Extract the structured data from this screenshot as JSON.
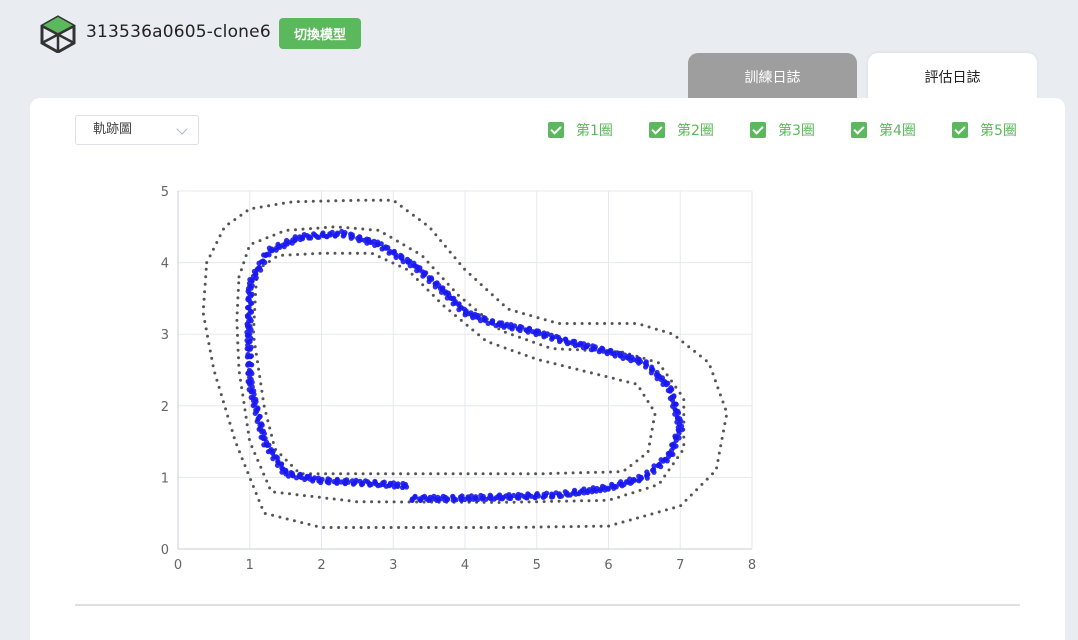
{
  "header": {
    "model_name": "313536a0605-clone6",
    "switch_button": "切換模型"
  },
  "tabs": [
    {
      "label": "訓練日誌",
      "active": false
    },
    {
      "label": "評估日誌",
      "active": true
    }
  ],
  "view_select": {
    "value": "軌跡圖"
  },
  "laps": [
    {
      "label": "第1圈",
      "checked": true
    },
    {
      "label": "第2圈",
      "checked": true
    },
    {
      "label": "第3圈",
      "checked": true
    },
    {
      "label": "第4圈",
      "checked": true
    },
    {
      "label": "第5圈",
      "checked": true
    }
  ],
  "colors": {
    "accent": "#5cb85c",
    "track": "#555555",
    "trajectory": "#1a1aee"
  },
  "chart_data": {
    "type": "scatter",
    "title": "",
    "xlabel": "",
    "ylabel": "",
    "xlim": [
      0,
      8
    ],
    "ylim": [
      0,
      5
    ],
    "xticks": [
      "0",
      "1",
      "2",
      "3",
      "4",
      "5",
      "6",
      "7",
      "8"
    ],
    "yticks": [
      "0",
      "1",
      "2",
      "3",
      "4",
      "5"
    ],
    "grid": true,
    "series": [
      {
        "role": "track-border-outer",
        "color": "#555555",
        "points": [
          [
            0.4,
            4.0
          ],
          [
            0.65,
            4.5
          ],
          [
            1.0,
            4.75
          ],
          [
            1.6,
            4.85
          ],
          [
            2.5,
            4.87
          ],
          [
            3.0,
            4.87
          ],
          [
            3.5,
            4.5
          ],
          [
            4.0,
            3.9
          ],
          [
            4.6,
            3.35
          ],
          [
            5.3,
            3.15
          ],
          [
            6.4,
            3.15
          ],
          [
            6.9,
            3.0
          ],
          [
            7.4,
            2.6
          ],
          [
            7.65,
            1.9
          ],
          [
            7.5,
            1.1
          ],
          [
            7.0,
            0.6
          ],
          [
            6.0,
            0.32
          ],
          [
            4.5,
            0.3
          ],
          [
            2.0,
            0.3
          ],
          [
            1.2,
            0.5
          ],
          [
            0.8,
            1.5
          ],
          [
            0.5,
            2.5
          ],
          [
            0.35,
            3.3
          ],
          [
            0.4,
            4.0
          ]
        ]
      },
      {
        "role": "track-border-inner",
        "color": "#555555",
        "points": [
          [
            1.1,
            3.9
          ],
          [
            1.4,
            4.1
          ],
          [
            2.0,
            4.13
          ],
          [
            2.7,
            4.13
          ],
          [
            3.2,
            3.9
          ],
          [
            3.7,
            3.4
          ],
          [
            4.3,
            2.9
          ],
          [
            5.0,
            2.65
          ],
          [
            6.0,
            2.4
          ],
          [
            6.4,
            2.3
          ],
          [
            6.65,
            1.9
          ],
          [
            6.55,
            1.35
          ],
          [
            6.2,
            1.08
          ],
          [
            5.0,
            1.05
          ],
          [
            3.0,
            1.05
          ],
          [
            1.7,
            1.05
          ],
          [
            1.35,
            1.4
          ],
          [
            1.2,
            2.0
          ],
          [
            1.05,
            3.0
          ],
          [
            1.1,
            3.9
          ]
        ]
      },
      {
        "role": "track-centerline",
        "color": "#555555",
        "points": [
          [
            0.85,
            3.8
          ],
          [
            1.0,
            4.25
          ],
          [
            1.5,
            4.45
          ],
          [
            2.2,
            4.5
          ],
          [
            2.8,
            4.45
          ],
          [
            3.4,
            4.1
          ],
          [
            3.9,
            3.55
          ],
          [
            4.5,
            3.05
          ],
          [
            5.2,
            2.8
          ],
          [
            6.2,
            2.75
          ],
          [
            6.7,
            2.6
          ],
          [
            7.05,
            2.1
          ],
          [
            7.05,
            1.4
          ],
          [
            6.7,
            0.9
          ],
          [
            6.0,
            0.68
          ],
          [
            4.5,
            0.65
          ],
          [
            2.5,
            0.66
          ],
          [
            1.3,
            0.8
          ],
          [
            1.0,
            1.5
          ],
          [
            0.85,
            2.5
          ],
          [
            0.82,
            3.2
          ],
          [
            0.85,
            3.8
          ]
        ]
      },
      {
        "role": "trajectory",
        "color": "#1a1aee",
        "points": [
          [
            3.15,
            0.88
          ],
          [
            2.6,
            0.92
          ],
          [
            2.0,
            0.95
          ],
          [
            1.5,
            1.05
          ],
          [
            1.2,
            1.5
          ],
          [
            1.0,
            2.3
          ],
          [
            0.98,
            3.0
          ],
          [
            1.0,
            3.7
          ],
          [
            1.25,
            4.15
          ],
          [
            1.7,
            4.35
          ],
          [
            2.3,
            4.4
          ],
          [
            2.8,
            4.25
          ],
          [
            3.3,
            3.95
          ],
          [
            3.7,
            3.6
          ],
          [
            4.0,
            3.3
          ],
          [
            4.4,
            3.15
          ],
          [
            4.9,
            3.05
          ],
          [
            5.4,
            2.9
          ],
          [
            6.0,
            2.75
          ],
          [
            6.5,
            2.6
          ],
          [
            6.85,
            2.25
          ],
          [
            7.0,
            1.7
          ],
          [
            6.85,
            1.3
          ],
          [
            6.5,
            1.0
          ],
          [
            6.0,
            0.85
          ],
          [
            5.3,
            0.75
          ],
          [
            4.5,
            0.72
          ],
          [
            3.8,
            0.7
          ],
          [
            3.2,
            0.7
          ]
        ]
      }
    ]
  }
}
